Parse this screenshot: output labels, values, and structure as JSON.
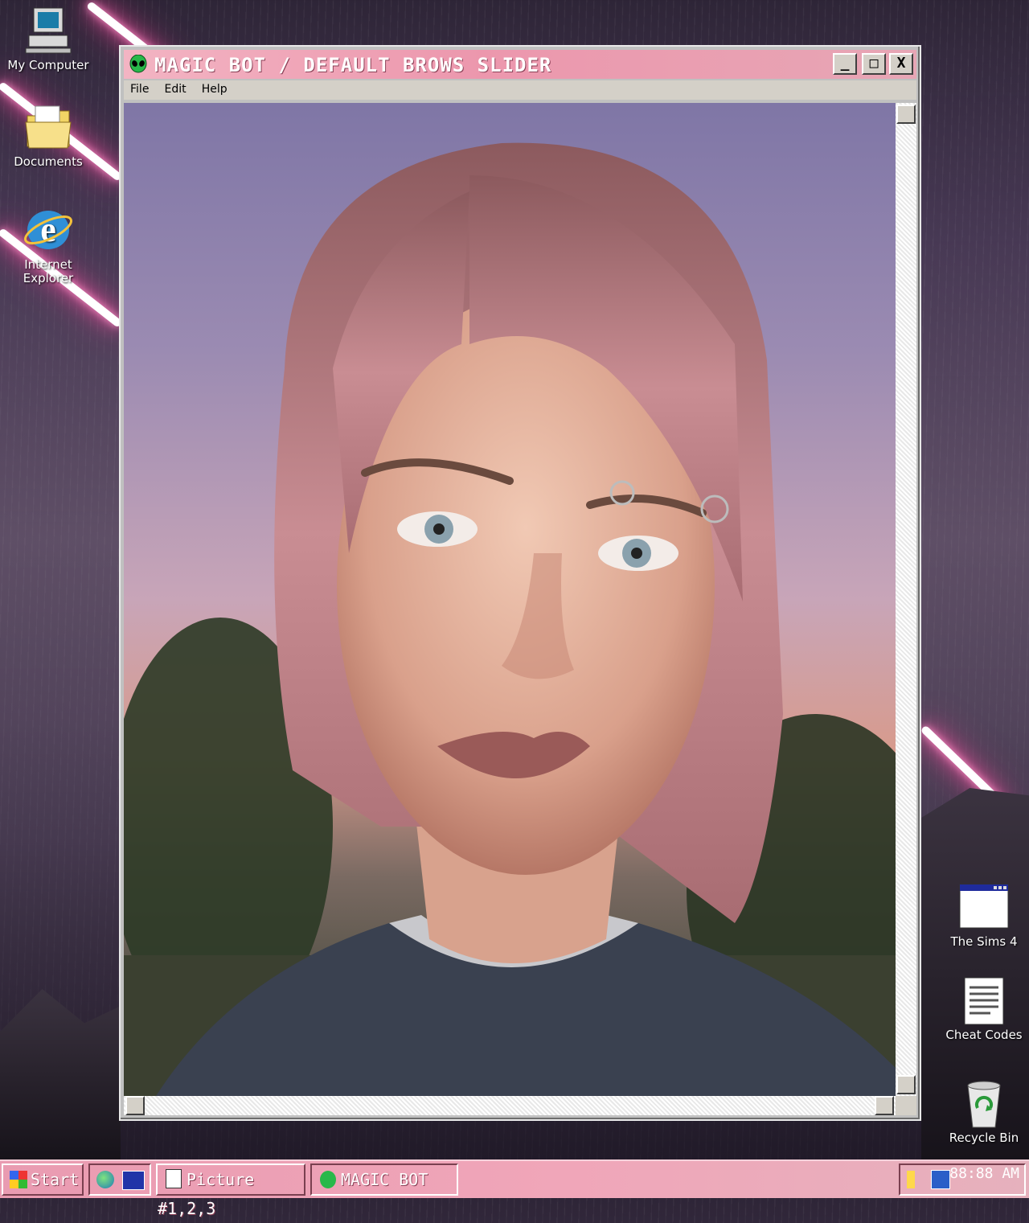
{
  "desktop": {
    "icons": [
      {
        "label": "My Computer",
        "icon": "computer-icon"
      },
      {
        "label": "Documents",
        "icon": "folder-icon"
      },
      {
        "label": "Internet Explorer",
        "icon": "internet-explorer-icon"
      },
      {
        "label": "The Sims 4",
        "icon": "window-app-icon"
      },
      {
        "label": "Cheat Codes",
        "icon": "text-document-icon"
      },
      {
        "label": "Recycle Bin",
        "icon": "recycle-bin-icon"
      }
    ]
  },
  "window": {
    "title": "MAGIC BOT / DEFAULT BROWS SLIDER",
    "title_icon": "alien-icon",
    "minimize": "_",
    "maximize": "□",
    "close": "X",
    "menu": [
      "File",
      "Edit",
      "Help"
    ]
  },
  "taskbar": {
    "start_label": "Start",
    "quicklaunch": [
      "globe-icon",
      "ms-dos-icon"
    ],
    "tasks": [
      {
        "label": "Picture #1,2,3",
        "icon": "picture-icon"
      },
      {
        "label": "MAGIC BOT",
        "icon": "alien-icon"
      }
    ],
    "tray_icons": [
      "speaker-icon",
      "network-computer-icon"
    ],
    "clock": "88:88 AM"
  },
  "colors": {
    "titlebar": "#ec97ad",
    "taskbar": "#f0a6b9",
    "window_chrome": "#c0c0c0"
  }
}
